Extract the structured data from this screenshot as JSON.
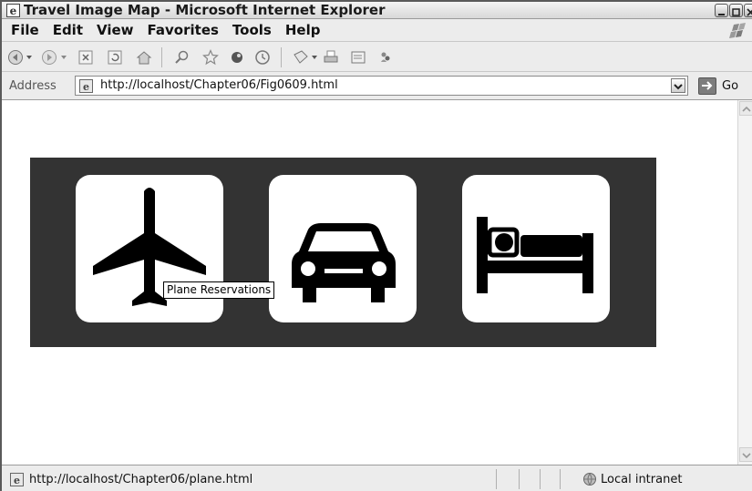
{
  "window": {
    "title": "Travel Image Map - Microsoft Internet Explorer"
  },
  "menu": {
    "items": [
      "File",
      "Edit",
      "View",
      "Favorites",
      "Tools",
      "Help"
    ]
  },
  "toolbar": {
    "icons": [
      "back-icon",
      "forward-icon",
      "stop-icon",
      "refresh-icon",
      "home-icon",
      "search-icon",
      "favorites-icon",
      "media-icon",
      "history-icon",
      "mail-icon",
      "print-icon",
      "edit-icon",
      "messenger-icon"
    ]
  },
  "address": {
    "label": "Address",
    "url": "http://localhost/Chapter06/Fig0609.html",
    "go_label": "Go"
  },
  "image_map": {
    "areas": [
      {
        "icon": "airplane-icon"
      },
      {
        "icon": "car-icon"
      },
      {
        "icon": "bed-icon"
      }
    ],
    "tooltip": "Plane Reservations"
  },
  "status": {
    "text": "http://localhost/Chapter06/plane.html",
    "zone": "Local intranet"
  }
}
